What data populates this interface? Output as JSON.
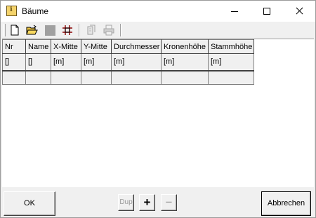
{
  "window": {
    "title": "Bäume"
  },
  "toolbar": {
    "buttons": [
      {
        "name": "new-document-icon",
        "enabled": true
      },
      {
        "name": "open-folder-icon",
        "enabled": true
      },
      {
        "name": "save-icon",
        "enabled": false
      },
      {
        "name": "grid-icon",
        "enabled": true
      },
      {
        "name": "copy-icon",
        "enabled": false
      },
      {
        "name": "print-icon",
        "enabled": false
      }
    ]
  },
  "grid": {
    "headers": [
      "Nr",
      "Name",
      "X-Mitte",
      "Y-Mitte",
      "Durchmesser",
      "Kronenhöhe",
      "Stammhöhe"
    ],
    "units": [
      "[]",
      "[]",
      "[m]",
      "[m]",
      "[m]",
      "[m]",
      "[m]"
    ]
  },
  "buttons": {
    "ok": "OK",
    "dup": "Dup",
    "plus": "+",
    "minus": "−",
    "cancel": "Abbrechen"
  },
  "colors": {
    "face": "#f0f0f0",
    "grid_line": "#808080",
    "disabled_text": "#9a9a9a"
  }
}
